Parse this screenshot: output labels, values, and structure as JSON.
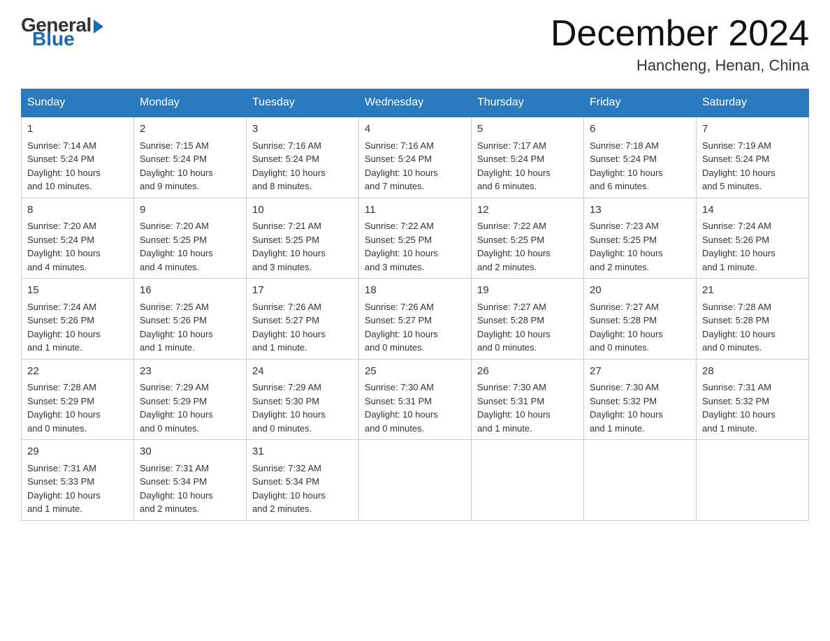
{
  "logo": {
    "general": "General",
    "blue": "Blue"
  },
  "header": {
    "month": "December 2024",
    "location": "Hancheng, Henan, China"
  },
  "days": [
    "Sunday",
    "Monday",
    "Tuesday",
    "Wednesday",
    "Thursday",
    "Friday",
    "Saturday"
  ],
  "weeks": [
    [
      {
        "day": "1",
        "sunrise": "7:14 AM",
        "sunset": "5:24 PM",
        "daylight": "10 hours and 10 minutes."
      },
      {
        "day": "2",
        "sunrise": "7:15 AM",
        "sunset": "5:24 PM",
        "daylight": "10 hours and 9 minutes."
      },
      {
        "day": "3",
        "sunrise": "7:16 AM",
        "sunset": "5:24 PM",
        "daylight": "10 hours and 8 minutes."
      },
      {
        "day": "4",
        "sunrise": "7:16 AM",
        "sunset": "5:24 PM",
        "daylight": "10 hours and 7 minutes."
      },
      {
        "day": "5",
        "sunrise": "7:17 AM",
        "sunset": "5:24 PM",
        "daylight": "10 hours and 6 minutes."
      },
      {
        "day": "6",
        "sunrise": "7:18 AM",
        "sunset": "5:24 PM",
        "daylight": "10 hours and 6 minutes."
      },
      {
        "day": "7",
        "sunrise": "7:19 AM",
        "sunset": "5:24 PM",
        "daylight": "10 hours and 5 minutes."
      }
    ],
    [
      {
        "day": "8",
        "sunrise": "7:20 AM",
        "sunset": "5:24 PM",
        "daylight": "10 hours and 4 minutes."
      },
      {
        "day": "9",
        "sunrise": "7:20 AM",
        "sunset": "5:25 PM",
        "daylight": "10 hours and 4 minutes."
      },
      {
        "day": "10",
        "sunrise": "7:21 AM",
        "sunset": "5:25 PM",
        "daylight": "10 hours and 3 minutes."
      },
      {
        "day": "11",
        "sunrise": "7:22 AM",
        "sunset": "5:25 PM",
        "daylight": "10 hours and 3 minutes."
      },
      {
        "day": "12",
        "sunrise": "7:22 AM",
        "sunset": "5:25 PM",
        "daylight": "10 hours and 2 minutes."
      },
      {
        "day": "13",
        "sunrise": "7:23 AM",
        "sunset": "5:25 PM",
        "daylight": "10 hours and 2 minutes."
      },
      {
        "day": "14",
        "sunrise": "7:24 AM",
        "sunset": "5:26 PM",
        "daylight": "10 hours and 1 minute."
      }
    ],
    [
      {
        "day": "15",
        "sunrise": "7:24 AM",
        "sunset": "5:26 PM",
        "daylight": "10 hours and 1 minute."
      },
      {
        "day": "16",
        "sunrise": "7:25 AM",
        "sunset": "5:26 PM",
        "daylight": "10 hours and 1 minute."
      },
      {
        "day": "17",
        "sunrise": "7:26 AM",
        "sunset": "5:27 PM",
        "daylight": "10 hours and 1 minute."
      },
      {
        "day": "18",
        "sunrise": "7:26 AM",
        "sunset": "5:27 PM",
        "daylight": "10 hours and 0 minutes."
      },
      {
        "day": "19",
        "sunrise": "7:27 AM",
        "sunset": "5:28 PM",
        "daylight": "10 hours and 0 minutes."
      },
      {
        "day": "20",
        "sunrise": "7:27 AM",
        "sunset": "5:28 PM",
        "daylight": "10 hours and 0 minutes."
      },
      {
        "day": "21",
        "sunrise": "7:28 AM",
        "sunset": "5:28 PM",
        "daylight": "10 hours and 0 minutes."
      }
    ],
    [
      {
        "day": "22",
        "sunrise": "7:28 AM",
        "sunset": "5:29 PM",
        "daylight": "10 hours and 0 minutes."
      },
      {
        "day": "23",
        "sunrise": "7:29 AM",
        "sunset": "5:29 PM",
        "daylight": "10 hours and 0 minutes."
      },
      {
        "day": "24",
        "sunrise": "7:29 AM",
        "sunset": "5:30 PM",
        "daylight": "10 hours and 0 minutes."
      },
      {
        "day": "25",
        "sunrise": "7:30 AM",
        "sunset": "5:31 PM",
        "daylight": "10 hours and 0 minutes."
      },
      {
        "day": "26",
        "sunrise": "7:30 AM",
        "sunset": "5:31 PM",
        "daylight": "10 hours and 1 minute."
      },
      {
        "day": "27",
        "sunrise": "7:30 AM",
        "sunset": "5:32 PM",
        "daylight": "10 hours and 1 minute."
      },
      {
        "day": "28",
        "sunrise": "7:31 AM",
        "sunset": "5:32 PM",
        "daylight": "10 hours and 1 minute."
      }
    ],
    [
      {
        "day": "29",
        "sunrise": "7:31 AM",
        "sunset": "5:33 PM",
        "daylight": "10 hours and 1 minute."
      },
      {
        "day": "30",
        "sunrise": "7:31 AM",
        "sunset": "5:34 PM",
        "daylight": "10 hours and 2 minutes."
      },
      {
        "day": "31",
        "sunrise": "7:32 AM",
        "sunset": "5:34 PM",
        "daylight": "10 hours and 2 minutes."
      },
      null,
      null,
      null,
      null
    ]
  ],
  "labels": {
    "sunrise": "Sunrise:",
    "sunset": "Sunset:",
    "daylight": "Daylight:"
  }
}
